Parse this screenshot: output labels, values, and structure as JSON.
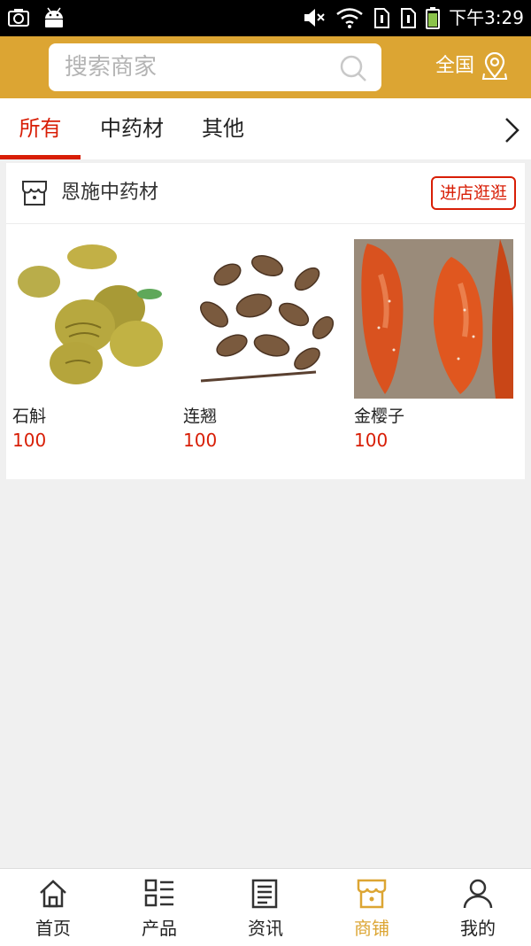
{
  "status_bar": {
    "time": "下午3:29"
  },
  "header": {
    "search_placeholder": "搜索商家",
    "region_label": "全国",
    "accent_color": "#dca533"
  },
  "tabs": [
    {
      "label": "所有",
      "active": true
    },
    {
      "label": "中药材",
      "active": false
    },
    {
      "label": "其他",
      "active": false
    }
  ],
  "shop": {
    "name": "恩施中药材",
    "visit_button": "进店逛逛",
    "products": [
      {
        "name": "石斛",
        "price": "100",
        "image": "dendrobium-photo"
      },
      {
        "name": "连翘",
        "price": "100",
        "image": "forsythia-photo"
      },
      {
        "name": "金樱子",
        "price": "100",
        "image": "rosa-laevigata-photo"
      }
    ]
  },
  "bottom_nav": [
    {
      "label": "首页",
      "icon": "home-icon",
      "active": false
    },
    {
      "label": "产品",
      "icon": "product-list-icon",
      "active": false
    },
    {
      "label": "资讯",
      "icon": "news-icon",
      "active": false
    },
    {
      "label": "商铺",
      "icon": "shop-icon",
      "active": true
    },
    {
      "label": "我的",
      "icon": "user-icon",
      "active": false
    }
  ]
}
